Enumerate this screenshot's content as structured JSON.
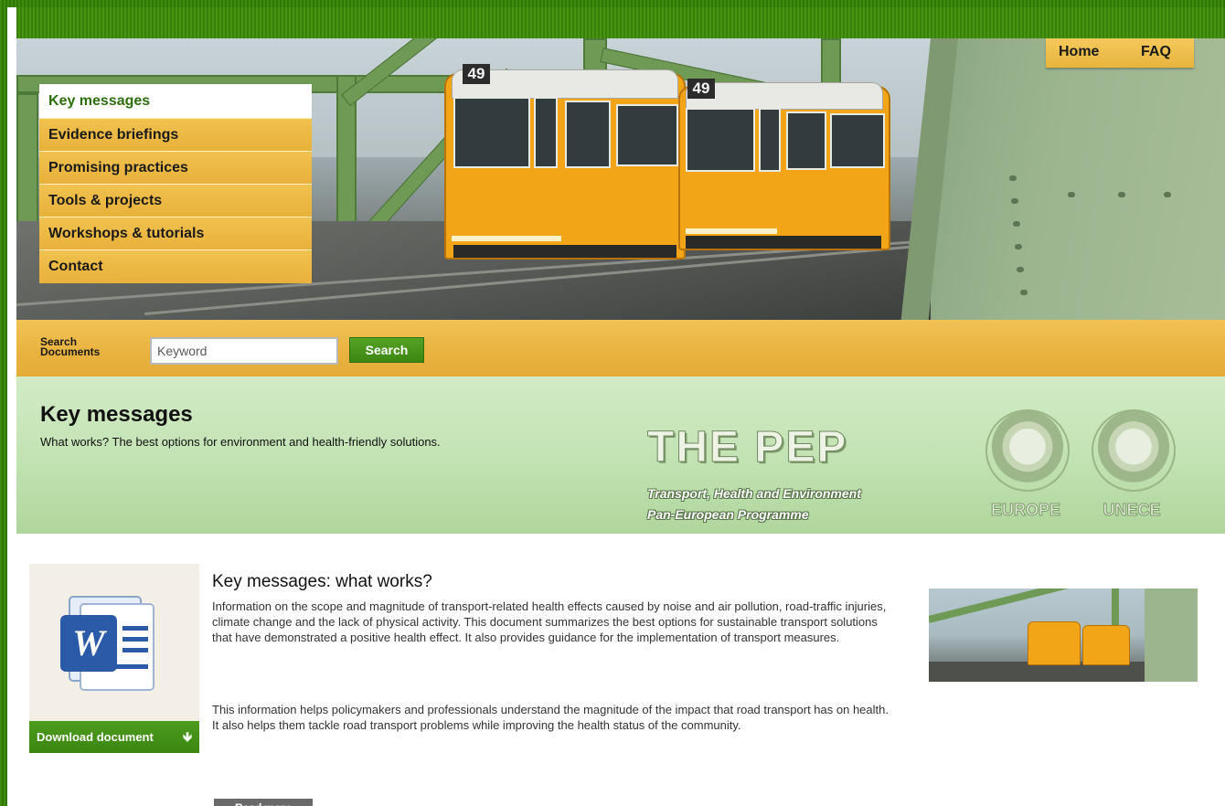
{
  "top_nav": {
    "home": "Home",
    "faq": "FAQ"
  },
  "banner": {
    "tram_number_1": "49",
    "tram_number_2": "49"
  },
  "menu": {
    "items": [
      {
        "label": "Key messages",
        "active": true
      },
      {
        "label": "Evidence briefings",
        "active": false
      },
      {
        "label": "Promising practices",
        "active": false
      },
      {
        "label": "Tools & projects",
        "active": false
      },
      {
        "label": "Workshops & tutorials",
        "active": false
      },
      {
        "label": "Contact",
        "active": false
      }
    ]
  },
  "search": {
    "label": "Search Documents",
    "placeholder": "Keyword",
    "value": "Keyword",
    "button": "Search"
  },
  "heading": {
    "title": "Key messages",
    "subtitle": "What works? The best options for environment and health-friendly solutions."
  },
  "pep_logo": {
    "title": "THE PEP",
    "line1": "Transport, Health and Environment",
    "line2": "Pan-European Programme",
    "emblem1_label": "EUROPE",
    "emblem2_label": "UNECE"
  },
  "article": {
    "title": "Key messages: what works?",
    "paragraph1": "Information on the scope and magnitude of transport-related health effects caused by noise and air pollution, road-traffic injuries, climate change and the lack of physical activity. This document summarizes the best options for sustainable transport solutions that have demonstrated a positive health effect. It also provides guidance for the implementation of transport measures.",
    "paragraph2": "This information helps policymakers and professionals understand the magnitude of the impact that road transport has on health. It also helps them tackle road transport problems while improving the health status of the community.",
    "download_label": "Download document",
    "read_more": "Read more"
  },
  "colors": {
    "frame_green": "#3f8a10",
    "menu_gold": "#e8b13a",
    "active_green_text": "#2d6e0c",
    "button_green": "#3a8611",
    "heading_band": "#c3e3b4"
  },
  "icons": [
    "word-document-icon",
    "download-arrow-icon"
  ]
}
